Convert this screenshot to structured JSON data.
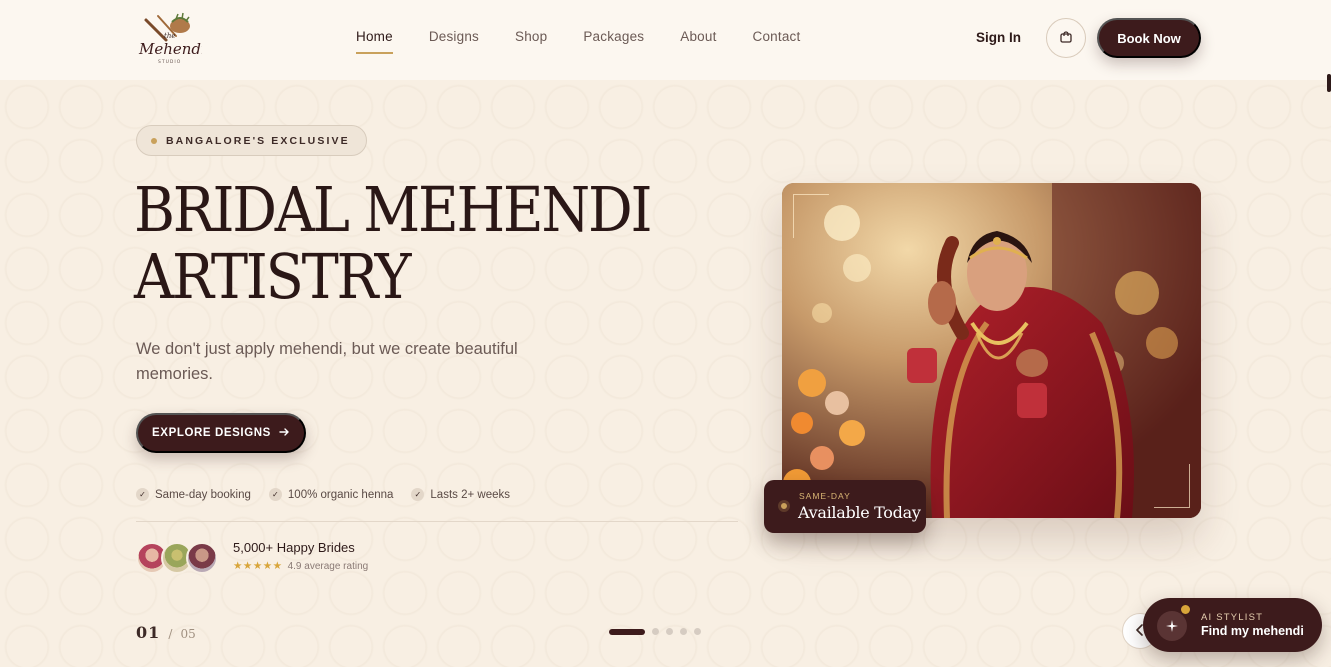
{
  "brand": {
    "logo_text": "Mehendi",
    "logo_small": "the",
    "logo_sub": "STUDIO"
  },
  "nav": {
    "links": [
      {
        "label": "Home",
        "active": true
      },
      {
        "label": "Designs",
        "active": false
      },
      {
        "label": "Shop",
        "active": false
      },
      {
        "label": "Packages",
        "active": false
      },
      {
        "label": "About",
        "active": false
      },
      {
        "label": "Contact",
        "active": false
      }
    ],
    "signin_label": "Sign In",
    "cart_icon": "shopping-bag-icon",
    "book_label": "Book Now"
  },
  "hero": {
    "badge": "BANGALORE'S EXCLUSIVE",
    "headline_line1": "BRIDAL MEHENDI",
    "headline_line2": "ARTISTRY",
    "subtitle": "We don't just apply mehendi, but we create beautiful memories.",
    "cta_label": "EXPLORE DESIGNS",
    "cta_icon": "arrow-right-icon",
    "features": [
      "Same-day booking",
      "100% organic henna",
      "Lasts 2+ weeks"
    ],
    "social_proof": {
      "title": "5,000+ Happy Brides",
      "stars": "★★★★★",
      "rating_text": "4.9 average rating"
    },
    "slide_current": "01",
    "slide_separator": "/",
    "slide_total": "05",
    "slide_active_index": 0,
    "slide_count": 5
  },
  "photo_card": {
    "availability_label": "SAME-DAY",
    "availability_title": "Available Today"
  },
  "ai_widget": {
    "label": "AI STYLIST",
    "title": "Find my mehendi",
    "icon": "sparkles-icon"
  },
  "colors": {
    "background": "#f8efe3",
    "primary": "#3d1b1c",
    "accent_gold": "#c9a15b",
    "text_dark": "#2e1a19",
    "text_muted": "#6b5a55"
  }
}
